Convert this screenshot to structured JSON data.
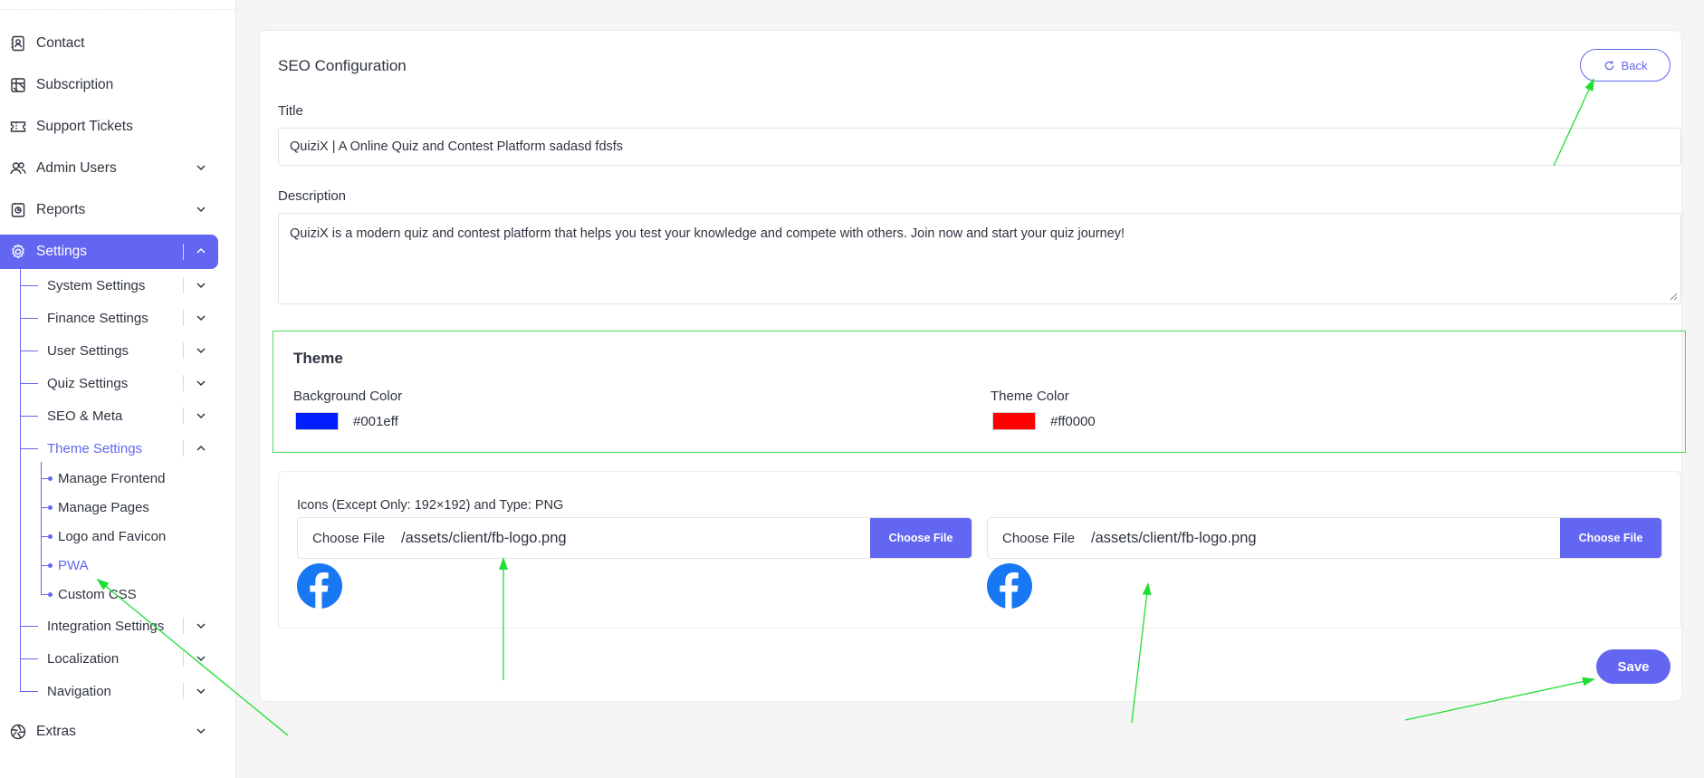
{
  "sidebar": {
    "items": [
      {
        "label": "Contact",
        "icon": "contact-book-icon"
      },
      {
        "label": "Subscription",
        "icon": "subscription-icon"
      },
      {
        "label": "Support Tickets",
        "icon": "ticket-icon"
      },
      {
        "label": "Admin Users",
        "icon": "users-icon"
      },
      {
        "label": "Reports",
        "icon": "reports-icon"
      },
      {
        "label": "Settings",
        "icon": "gear-icon"
      },
      {
        "label": "Extras",
        "icon": "aperture-icon"
      }
    ],
    "settings_sub": [
      {
        "label": "System Settings"
      },
      {
        "label": "Finance Settings"
      },
      {
        "label": "User Settings"
      },
      {
        "label": "Quiz Settings"
      },
      {
        "label": "SEO & Meta"
      },
      {
        "label": "Theme Settings"
      },
      {
        "label": "Integration Settings"
      },
      {
        "label": "Localization"
      },
      {
        "label": "Navigation"
      }
    ],
    "theme_sub": [
      {
        "label": "Manage Frontend"
      },
      {
        "label": "Manage Pages"
      },
      {
        "label": "Logo and Favicon"
      },
      {
        "label": "PWA"
      },
      {
        "label": "Custom CSS"
      }
    ]
  },
  "main": {
    "card_title": "SEO Configuration",
    "back_label": "Back",
    "title_label": "Title",
    "title_value": "QuiziX | A Online Quiz and Contest Platform sadasd fdsfs",
    "description_label": "Description",
    "description_value": "QuiziX is a modern quiz and contest platform that helps you test your knowledge and compete with others. Join now and start your quiz journey!",
    "theme": {
      "heading": "Theme",
      "background_label": "Background Color",
      "background_value": "#001eff",
      "theme_color_label": "Theme Color",
      "theme_color_value": "#ff0000"
    },
    "icons": {
      "heading": "Icons (Except Only: 192×192) and Type: PNG",
      "files": [
        {
          "choose_label": "Choose File",
          "path": "/assets/client/fb-logo.png",
          "button": "Choose File"
        },
        {
          "choose_label": "Choose File",
          "path": "/assets/client/fb-logo.png",
          "button": "Choose File"
        }
      ]
    },
    "save_label": "Save"
  },
  "colors": {
    "accent": "#6366f1",
    "highlight_border": "#4ade5a",
    "facebook": "#1877f2"
  }
}
